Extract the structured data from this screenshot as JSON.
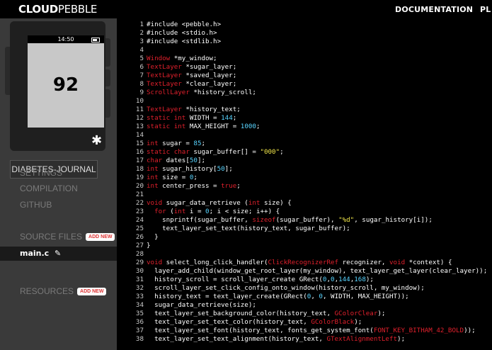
{
  "header": {
    "logo_bold": "CLOUD",
    "logo_regular": "PEBBLE",
    "nav": [
      "DOCUMENTATION",
      "PL"
    ]
  },
  "emulator": {
    "time": "14:50",
    "value": "92"
  },
  "sidebar": {
    "project_name": "DIABETES-JOURNAL",
    "items": [
      "SETTINGS",
      "COMPILATION",
      "GITHUB"
    ],
    "source_files_title": "SOURCE FILES",
    "add_new_label": "ADD NEW",
    "files": [
      "main.c"
    ],
    "resources_title": "RESOURCES"
  },
  "colors": {
    "keyword": "#e0202c",
    "string": "#f0e64a",
    "number": "#58d4ff",
    "text": "#ffffff"
  },
  "code_lines": [
    [
      [
        "p",
        "#include <pebble.h>"
      ]
    ],
    [
      [
        "p",
        "#include <stdio.h>"
      ]
    ],
    [
      [
        "p",
        "#include <stdlib.h>"
      ]
    ],
    [],
    [
      [
        "t",
        "Window"
      ],
      [
        "x",
        " *my_window;"
      ]
    ],
    [
      [
        "t",
        "TextLayer"
      ],
      [
        "x",
        " *sugar_layer;"
      ]
    ],
    [
      [
        "t",
        "TextLayer"
      ],
      [
        "x",
        " *saved_layer;"
      ]
    ],
    [
      [
        "t",
        "TextLayer"
      ],
      [
        "x",
        " *clear_layer;"
      ]
    ],
    [
      [
        "t",
        "ScrollLayer"
      ],
      [
        "x",
        " *history_scroll;"
      ]
    ],
    [],
    [
      [
        "t",
        "TextLayer"
      ],
      [
        "x",
        " *history_text;"
      ]
    ],
    [
      [
        "k",
        "static int"
      ],
      [
        "x",
        " WIDTH = "
      ],
      [
        "n",
        "144"
      ],
      [
        "x",
        ";"
      ]
    ],
    [
      [
        "k",
        "static int"
      ],
      [
        "x",
        " MAX_HEIGHT = "
      ],
      [
        "n",
        "1000"
      ],
      [
        "x",
        ";"
      ]
    ],
    [],
    [
      [
        "k",
        "int"
      ],
      [
        "x",
        " sugar = "
      ],
      [
        "n",
        "85"
      ],
      [
        "x",
        ";"
      ]
    ],
    [
      [
        "k",
        "static char"
      ],
      [
        "x",
        " sugar_buffer[] = "
      ],
      [
        "s",
        "\"000\""
      ],
      [
        "x",
        ";"
      ]
    ],
    [
      [
        "k",
        "char"
      ],
      [
        "x",
        " dates["
      ],
      [
        "n",
        "50"
      ],
      [
        "x",
        "];"
      ]
    ],
    [
      [
        "k",
        "int"
      ],
      [
        "x",
        " sugar_history["
      ],
      [
        "n",
        "50"
      ],
      [
        "x",
        "];"
      ]
    ],
    [
      [
        "k",
        "int"
      ],
      [
        "x",
        " size = "
      ],
      [
        "n",
        "0"
      ],
      [
        "x",
        ";"
      ]
    ],
    [
      [
        "k",
        "int"
      ],
      [
        "x",
        " center_press = "
      ],
      [
        "k",
        "true"
      ],
      [
        "x",
        ";"
      ]
    ],
    [],
    [
      [
        "k",
        "void"
      ],
      [
        "x",
        " sugar_data_retrieve ("
      ],
      [
        "k",
        "int"
      ],
      [
        "x",
        " size) {"
      ]
    ],
    [
      [
        "x",
        "  "
      ],
      [
        "k",
        "for"
      ],
      [
        "x",
        " ("
      ],
      [
        "k",
        "int"
      ],
      [
        "x",
        " i = "
      ],
      [
        "n",
        "0"
      ],
      [
        "x",
        "; i < size; i++) {"
      ]
    ],
    [
      [
        "x",
        "    snprintf(sugar_buffer, "
      ],
      [
        "k",
        "sizeof"
      ],
      [
        "x",
        "(sugar_buffer), "
      ],
      [
        "s",
        "\"%d\""
      ],
      [
        "x",
        ", sugar_history[i]);"
      ]
    ],
    [
      [
        "x",
        "    text_layer_set_text(history_text, sugar_buffer);"
      ]
    ],
    [
      [
        "x",
        "  }"
      ]
    ],
    [
      [
        "x",
        "}"
      ]
    ],
    [],
    [
      [
        "k",
        "void"
      ],
      [
        "x",
        " select_long_click_handler("
      ],
      [
        "t",
        "ClickRecognizerRef"
      ],
      [
        "x",
        " recognizer, "
      ],
      [
        "k",
        "void"
      ],
      [
        "x",
        " *context) {"
      ]
    ],
    [
      [
        "x",
        "  layer_add_child(window_get_root_layer(my_window), text_layer_get_layer(clear_layer));"
      ]
    ],
    [
      [
        "x",
        "  history_scroll = scroll_layer_create GRect("
      ],
      [
        "n",
        "0"
      ],
      [
        "x",
        ","
      ],
      [
        "n",
        "0"
      ],
      [
        "x",
        ","
      ],
      [
        "n",
        "144"
      ],
      [
        "x",
        ","
      ],
      [
        "n",
        "168"
      ],
      [
        "x",
        ");"
      ]
    ],
    [
      [
        "x",
        "  scroll_layer_set_click_config_onto_window(history_scroll, my_window);"
      ]
    ],
    [
      [
        "x",
        "  history_text = text_layer_create(GRect("
      ],
      [
        "n",
        "0"
      ],
      [
        "x",
        ", "
      ],
      [
        "n",
        "0"
      ],
      [
        "x",
        ", WIDTH, MAX_HEIGHT));"
      ]
    ],
    [
      [
        "x",
        "  sugar_data_retrieve(size);"
      ]
    ],
    [
      [
        "x",
        "  text_layer_set_background_color(history_text, "
      ],
      [
        "k",
        "GColorClear"
      ],
      [
        "x",
        ");"
      ]
    ],
    [
      [
        "x",
        "  text_layer_set_text_color(history_text, "
      ],
      [
        "k",
        "GColorBlack"
      ],
      [
        "x",
        ");"
      ]
    ],
    [
      [
        "x",
        "  text_layer_set_font(history_text, fonts_get_system_font("
      ],
      [
        "k",
        "FONT_KEY_BITHAM_42_BOLD"
      ],
      [
        "x",
        "));"
      ]
    ],
    [
      [
        "x",
        "  text_layer_set_text_alignment(history_text, "
      ],
      [
        "k",
        "GTextAlignmentLeft"
      ],
      [
        "x",
        ");"
      ]
    ]
  ]
}
